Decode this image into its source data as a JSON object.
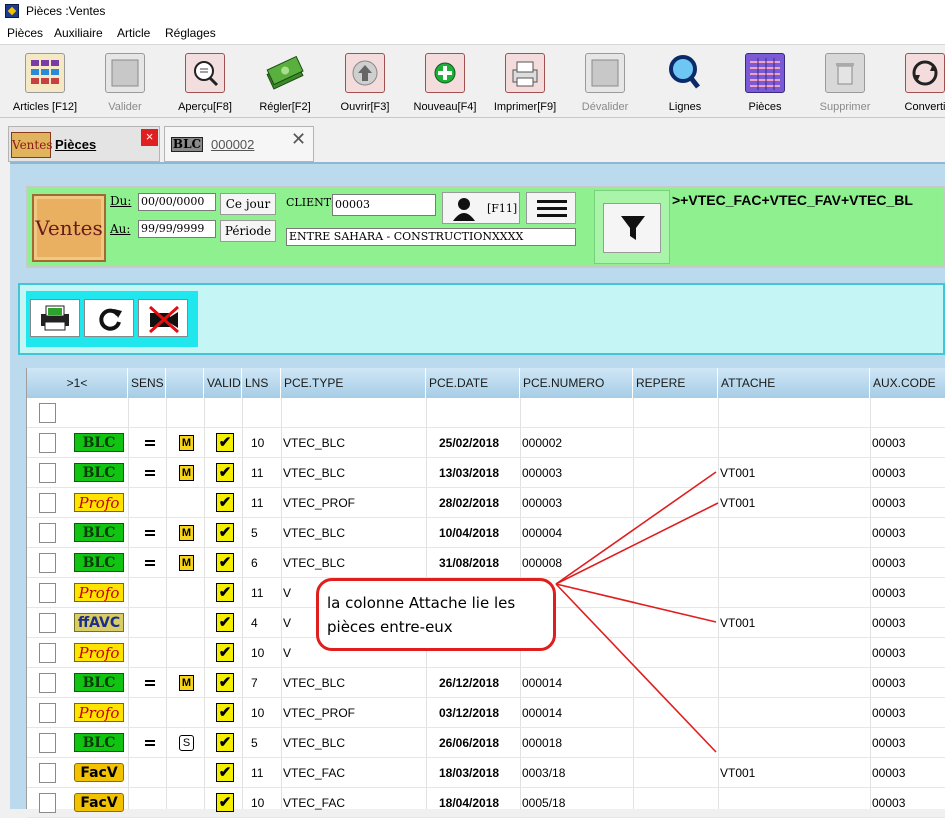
{
  "window": {
    "title": "Pièces :Ventes"
  },
  "menu": [
    "Pièces",
    "Auxiliaire",
    "Article",
    "Réglages"
  ],
  "toolbar": [
    {
      "label": "Articles [F12]",
      "icon": "articles-grid-icon",
      "enabled": true
    },
    {
      "label": "Valider",
      "icon": "validate-icon",
      "enabled": false
    },
    {
      "label": "Aperçu[F8]",
      "icon": "preview-magnifier-icon",
      "enabled": true
    },
    {
      "label": "Régler[F2]",
      "icon": "money-stack-icon",
      "enabled": true
    },
    {
      "label": "Ouvrir[F3]",
      "icon": "open-arrow-up-icon",
      "enabled": true
    },
    {
      "label": "Nouveau[F4]",
      "icon": "new-plus-icon",
      "enabled": true
    },
    {
      "label": "Imprimer[F9]",
      "icon": "printer-icon",
      "enabled": true
    },
    {
      "label": "Dévalider",
      "icon": "unvalidate-icon",
      "enabled": false
    },
    {
      "label": "Lignes",
      "icon": "lines-search-icon",
      "enabled": true
    },
    {
      "label": "Pièces",
      "icon": "pieces-grid-icon",
      "enabled": true
    },
    {
      "label": "Supprimer",
      "icon": "trash-icon",
      "enabled": false
    },
    {
      "label": "Converti",
      "icon": "convert-icon",
      "enabled": true
    }
  ],
  "tabs": [
    {
      "badge": "Ventes",
      "label": "Pièces",
      "close": "×"
    },
    {
      "badge": "BLC",
      "label": "000002",
      "close": "✕"
    }
  ],
  "filter": {
    "logo": "Ventes",
    "du_label": "Du:",
    "du_value": "00/00/0000",
    "au_label": "Au:",
    "au_value": "99/99/9999",
    "ce_jour": "Ce jour",
    "periode": "Période",
    "client_label": "CLIENT:",
    "client_value": "00003",
    "client_name": "ENTRE SAHARA - CONSTRUCTIONXXXX",
    "f11": "[F11]",
    "types_text": ">+VTEC_FAC+VTEC_FAV+VTEC_BL"
  },
  "grid": {
    "columns": [
      ">1<",
      "SENS",
      "",
      "VALID",
      "LNS",
      "PCE.TYPE",
      "PCE.DATE",
      "PCE.NUMERO",
      "REPERE",
      "ATTACHE",
      "AUX.CODE"
    ],
    "rows": [
      {
        "badge": "",
        "sens": false,
        "mark": "",
        "valid": false,
        "lns": "",
        "type": "",
        "date": "",
        "numero": "",
        "repere": "",
        "attache": "",
        "aux": ""
      },
      {
        "badge": "BLC",
        "sens": true,
        "mark": "M",
        "valid": true,
        "lns": "10",
        "type": "VTEC_BLC",
        "date": "25/02/2018",
        "numero": "000002",
        "repere": "",
        "attache": "",
        "aux": "00003"
      },
      {
        "badge": "BLC",
        "sens": true,
        "mark": "M",
        "valid": true,
        "lns": "11",
        "type": "VTEC_BLC",
        "date": "13/03/2018",
        "numero": "000003",
        "repere": "",
        "attache": "VT001",
        "aux": "00003"
      },
      {
        "badge": "Profo",
        "sens": false,
        "mark": "",
        "valid": true,
        "lns": "11",
        "type": "VTEC_PROF",
        "date": "28/02/2018",
        "numero": "000003",
        "repere": "",
        "attache": "VT001",
        "aux": "00003"
      },
      {
        "badge": "BLC",
        "sens": true,
        "mark": "M",
        "valid": true,
        "lns": "5",
        "type": "VTEC_BLC",
        "date": "10/04/2018",
        "numero": "000004",
        "repere": "",
        "attache": "",
        "aux": "00003"
      },
      {
        "badge": "BLC",
        "sens": true,
        "mark": "M",
        "valid": true,
        "lns": "6",
        "type": "VTEC_BLC",
        "date": "31/08/2018",
        "numero": "000008",
        "repere": "",
        "attache": "",
        "aux": "00003"
      },
      {
        "badge": "Profo",
        "sens": false,
        "mark": "",
        "valid": true,
        "lns": "11",
        "type": "V",
        "date": "",
        "numero": "",
        "repere": "",
        "attache": "",
        "aux": "00003"
      },
      {
        "badge": "ffAVC",
        "sens": false,
        "mark": "",
        "valid": true,
        "lns": "4",
        "type": "V",
        "date": "",
        "numero": "",
        "repere": "",
        "attache": "VT001",
        "aux": "00003"
      },
      {
        "badge": "Profo",
        "sens": false,
        "mark": "",
        "valid": true,
        "lns": "10",
        "type": "V",
        "date": "",
        "numero": "",
        "repere": "",
        "attache": "",
        "aux": "00003"
      },
      {
        "badge": "BLC",
        "sens": true,
        "mark": "M",
        "valid": true,
        "lns": "7",
        "type": "VTEC_BLC",
        "date": "26/12/2018",
        "numero": "000014",
        "repere": "",
        "attache": "",
        "aux": "00003"
      },
      {
        "badge": "Profo",
        "sens": false,
        "mark": "",
        "valid": true,
        "lns": "10",
        "type": "VTEC_PROF",
        "date": "03/12/2018",
        "numero": "000014",
        "repere": "",
        "attache": "",
        "aux": "00003"
      },
      {
        "badge": "BLC",
        "sens": true,
        "mark": "S",
        "valid": true,
        "lns": "5",
        "type": "VTEC_BLC",
        "date": "26/06/2018",
        "numero": "000018",
        "repere": "",
        "attache": "",
        "aux": "00003"
      },
      {
        "badge": "FacV",
        "sens": false,
        "mark": "",
        "valid": true,
        "lns": "11",
        "type": "VTEC_FAC",
        "date": "18/03/2018",
        "numero": "0003/18",
        "repere": "",
        "attache": "VT001",
        "aux": "00003"
      },
      {
        "badge": "FacV",
        "sens": false,
        "mark": "",
        "valid": true,
        "lns": "10",
        "type": "VTEC_FAC",
        "date": "18/04/2018",
        "numero": "0005/18",
        "repere": "",
        "attache": "",
        "aux": "00003"
      }
    ]
  },
  "callout": {
    "line1": "la colonne Attache lie les",
    "line2": "pièces entre-eux"
  },
  "colors": {
    "green_panel": "#8ef08e",
    "cyan_bar": "#20e6ee",
    "header_blue": "#a6cde6",
    "annotation_red": "#e01e1e"
  }
}
